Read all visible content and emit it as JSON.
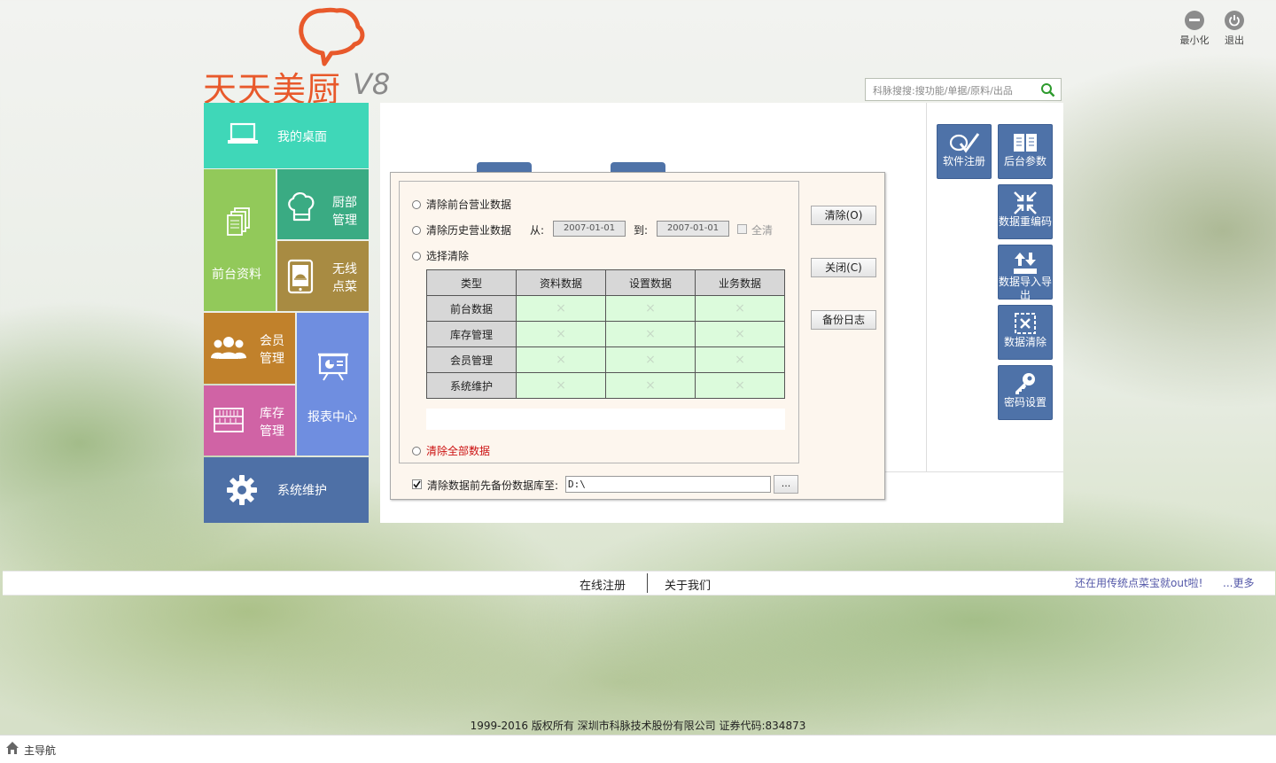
{
  "app": {
    "logo_text": "天天美厨",
    "logo_version": "V8",
    "minimize_label": "最小化",
    "exit_label": "退出"
  },
  "search": {
    "placeholder": "科脉搜搜:搜功能/单据/原料/出品"
  },
  "nav": {
    "desktop": "我的桌面",
    "front_data": "前台资料",
    "kitchen_line1": "厨部",
    "kitchen_line2": "管理",
    "wireless_line1": "无线",
    "wireless_line2": "点菜",
    "member_line1": "会员",
    "member_line2": "管理",
    "report": "报表中心",
    "stock_line1": "库存",
    "stock_line2": "管理",
    "system": "系统维护"
  },
  "tools": [
    {
      "label": "软件注册",
      "icon": "register-icon"
    },
    {
      "label": "后台参数",
      "icon": "book-icon"
    },
    {
      "label": "数据重编码",
      "icon": "compress-icon"
    },
    {
      "label": "数据导入导出",
      "icon": "import-export-icon"
    },
    {
      "label": "数据清除",
      "icon": "clear-data-icon"
    },
    {
      "label": "密码设置",
      "icon": "key-icon"
    }
  ],
  "dialog": {
    "opt_clear_front": "清除前台营业数据",
    "opt_clear_history": "清除历史营业数据",
    "from_label": "从:",
    "to_label": "到:",
    "date_from": "2007-01-01",
    "date_to": "2007-01-01",
    "all_clear_label": "全清",
    "opt_select_clear": "选择清除",
    "table_headers": [
      "类型",
      "资料数据",
      "设置数据",
      "业务数据"
    ],
    "table_rows": [
      {
        "label": "前台数据",
        "cells": [
          "×",
          "×",
          "×"
        ]
      },
      {
        "label": "库存管理",
        "cells": [
          "×",
          "×",
          "×"
        ]
      },
      {
        "label": "会员管理",
        "cells": [
          "×",
          "×",
          "×"
        ]
      },
      {
        "label": "系统维护",
        "cells": [
          "×",
          "×",
          "×"
        ]
      }
    ],
    "opt_clear_all": "清除全部数据",
    "btn_clear": "清除(O)",
    "btn_close": "关闭(C)",
    "btn_backup_log": "备份日志",
    "backup_label": "清除数据前先备份数据库至:",
    "backup_path": "D:\\",
    "browse_label": "..."
  },
  "footer": {
    "online_register": "在线注册",
    "about_us": "关于我们",
    "promo": "还在用传统点菜宝就out啦!",
    "more": "...更多",
    "copyright": "1999-2016  版权所有  深圳市科脉技术股份有限公司  证券代码:834873",
    "status_home": "主导航"
  },
  "colors": {
    "logo": "#e8592b",
    "tile_desktop": "#3fd7b8",
    "tile_front": "#92c95a",
    "tile_kitchen": "#3aab83",
    "tile_wireless": "#a88b42",
    "tile_member": "#c1812b",
    "tile_report": "#6f8ee0",
    "tile_stock": "#d063a5",
    "tile_system": "#4e70a6",
    "tool_button": "#4e72a8",
    "clear_all_text": "#cc1111",
    "promo_text": "#5458a8"
  }
}
